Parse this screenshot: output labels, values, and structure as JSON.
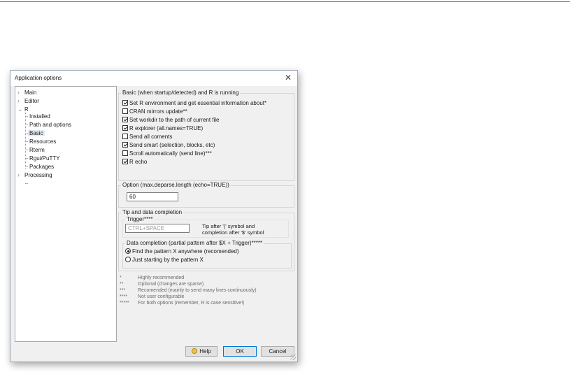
{
  "window": {
    "title": "Application options",
    "close_glyph": "✕"
  },
  "tree": {
    "items": [
      {
        "label": "Main",
        "expandable": true
      },
      {
        "label": "Editor",
        "expandable": true
      },
      {
        "label": "R",
        "expanded": true
      },
      {
        "label": "Installed"
      },
      {
        "label": "Path and options"
      },
      {
        "label": "Basic",
        "selected": true
      },
      {
        "label": "Resources"
      },
      {
        "label": "Rterm"
      },
      {
        "label": "Rgui/PuTTY"
      },
      {
        "label": "Packages"
      },
      {
        "label": "Processing",
        "expandable": true
      }
    ]
  },
  "basic": {
    "group_title": "Basic (when startup/detected) and R is running",
    "options": [
      {
        "label": "Set R environment and get essential information about*",
        "checked": true
      },
      {
        "label": "CRAN mirrors update**",
        "checked": false
      },
      {
        "label": "Set workdir to the path of current file",
        "checked": true
      },
      {
        "label": "R explorer (all.names=TRUE)",
        "checked": true
      },
      {
        "label": "Send all coments",
        "checked": false
      },
      {
        "label": "Send smart (selection, blocks, etc)",
        "checked": true
      },
      {
        "label": "Scroll automatically (send line)***",
        "checked": false
      },
      {
        "label": "R echo",
        "checked": true
      }
    ]
  },
  "option": {
    "group_title": "Option (max.deparse.length (echo=TRUE))",
    "value": "60"
  },
  "tip": {
    "group_title": "Tip and data completion",
    "trigger_label": "Trigger****",
    "trigger_placeholder": "CTRL+SPACE",
    "trigger_help_line1": "Tip after '(' symbol and",
    "trigger_help_line2": "completion after '$' symbol",
    "completion_title": "Data completion (partial pattern after $X + Trigger)*****",
    "radios": [
      {
        "label": "Find the pattern X anywhere (recomended)",
        "selected": true
      },
      {
        "label": "Just starting by the pattern X",
        "selected": false
      }
    ]
  },
  "notes": [
    {
      "mark": "*",
      "text": "Highly recommended"
    },
    {
      "mark": "**",
      "text": "Optional (changes are sparse)"
    },
    {
      "mark": "***",
      "text": "Recomended (mainly to send many lines continuously)"
    },
    {
      "mark": "****",
      "text": "Not user configurable"
    },
    {
      "mark": "*****",
      "text": "For both options (remember, R is case sensitive!)"
    }
  ],
  "buttons": {
    "help": "Help",
    "ok": "OK",
    "cancel": "Cancel"
  },
  "colors": {
    "selection": "#e1e9f3",
    "dialog_bg": "#f0f0f0",
    "default_button_border": "#0078d7"
  },
  "icons": {
    "help": "help-bulb-icon",
    "close": "close-icon",
    "expand": "chevron-right-icon",
    "collapse": "chevron-down-icon"
  }
}
